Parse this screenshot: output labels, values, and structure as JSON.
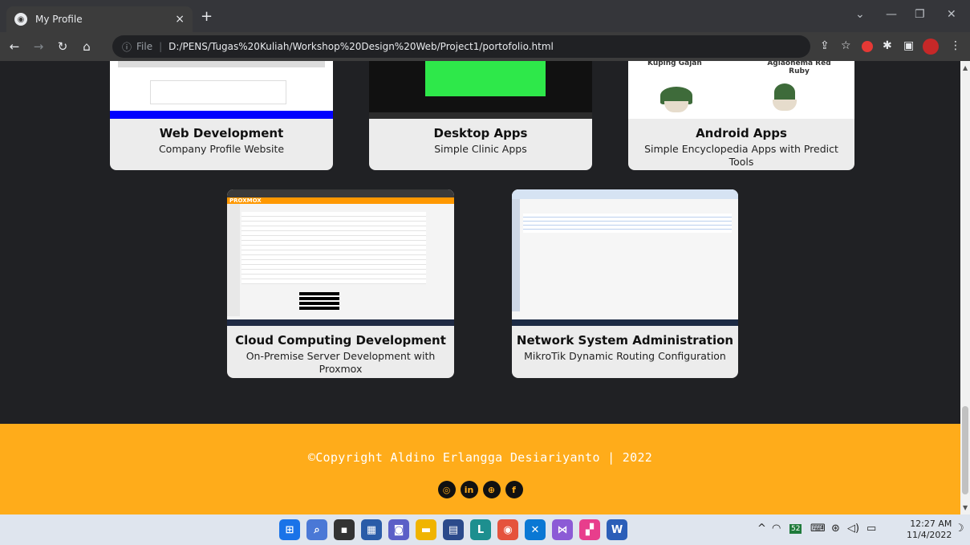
{
  "browser": {
    "tab_title": "My Profile",
    "tab_close": "×",
    "new_tab": "+",
    "url_info": "ⓘ",
    "url_scheme": "File",
    "url_sep": "|",
    "url": "D:/PENS/Tugas%20Kuliah/Workshop%20Design%20Web/Project1/portofolio.html"
  },
  "projects": [
    {
      "title": "Web Development",
      "subtitle": "Company Profile Website"
    },
    {
      "title": "Desktop Apps",
      "subtitle": "Simple Clinic Apps"
    },
    {
      "title": "Android Apps",
      "subtitle": "Simple Encyclopedia Apps with Predict Tools"
    },
    {
      "title": "Cloud Computing Development",
      "subtitle": "On-Premise Server Development with Proxmox"
    },
    {
      "title": "Network System Administration",
      "subtitle": "MikroTik Dynamic Routing Configuration"
    }
  ],
  "thumb_text": {
    "android_left": "Kuping Gajah",
    "android_right": "Aglaonema Red Ruby",
    "cloud_brand": "PROXMOX"
  },
  "footer": {
    "copyright": "©Copyright Aldino Erlangga Desiariyanto | 2022",
    "socials": [
      "instagram-icon",
      "linkedin-icon",
      "globe-icon",
      "facebook-icon"
    ]
  },
  "taskbar": {
    "time": "12:27 AM",
    "date": "11/4/2022",
    "badge": "52"
  },
  "colors": {
    "footer_bg": "#ffac1a",
    "page_bg": "#202124",
    "card_bg": "#ececec"
  }
}
